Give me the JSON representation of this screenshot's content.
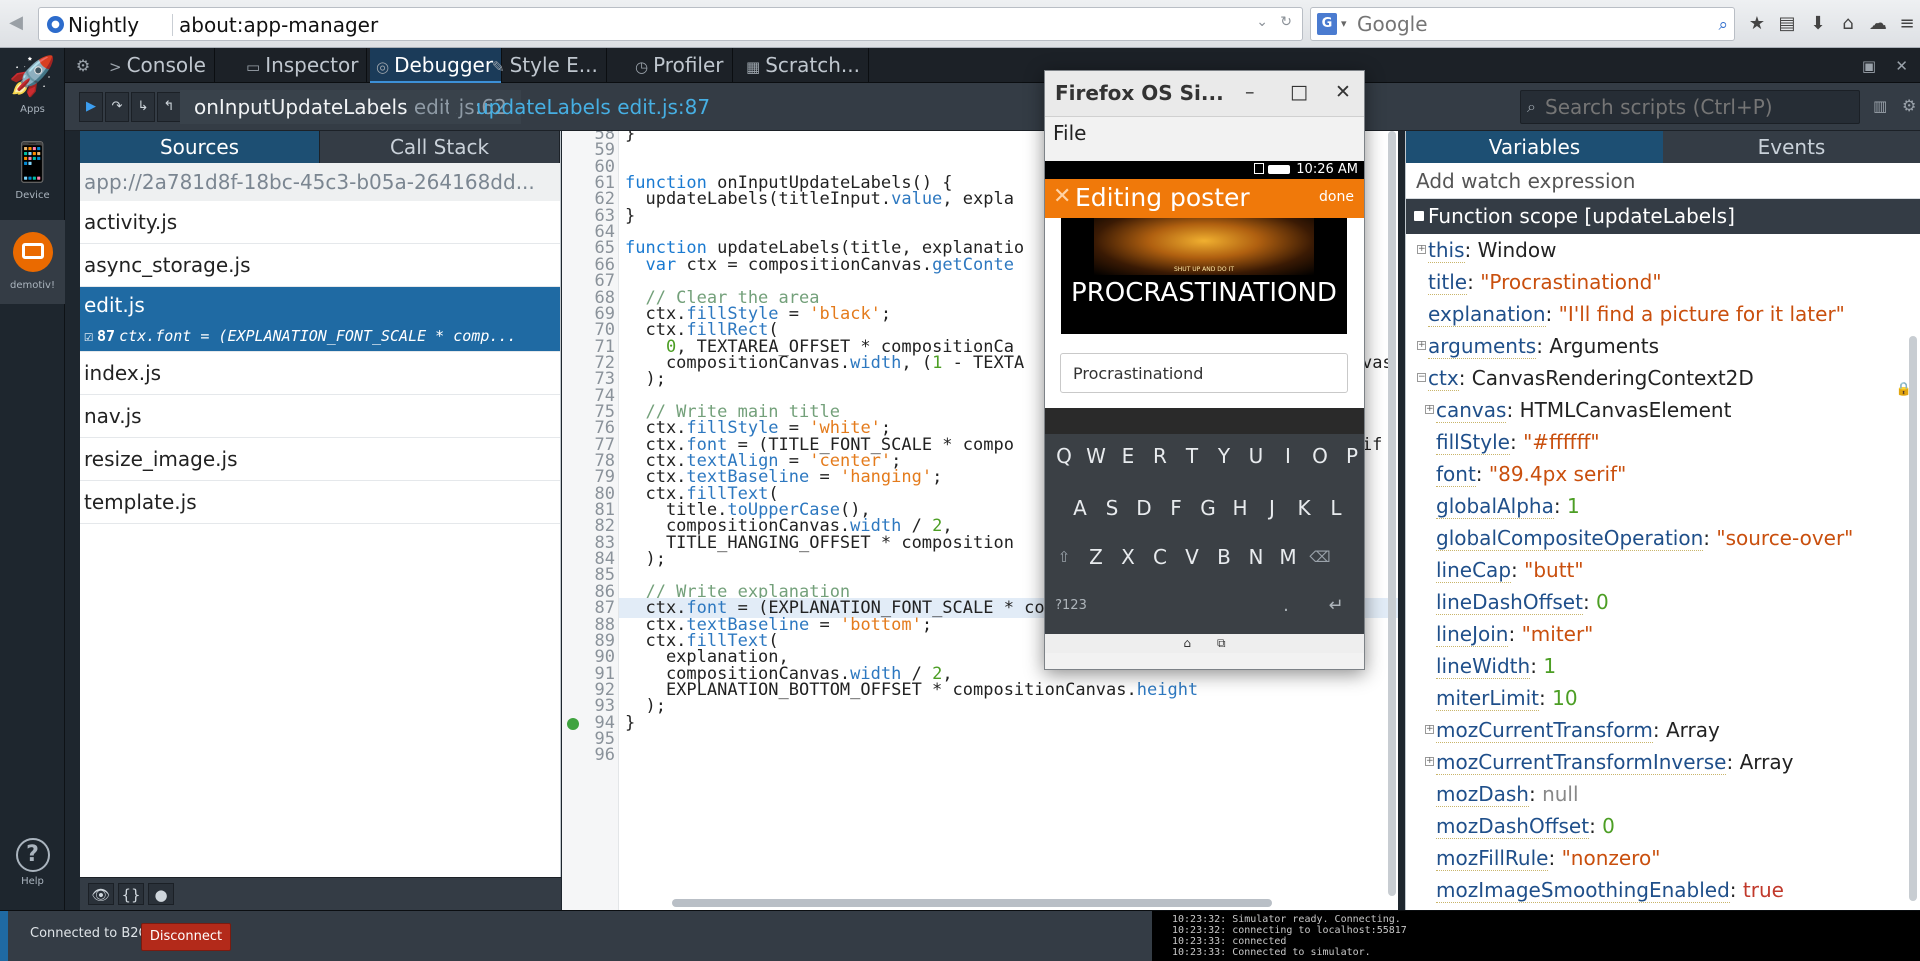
{
  "browser": {
    "brand": "Nightly",
    "url": "about:app-manager",
    "search_placeholder": "Google",
    "engine_letter": "G"
  },
  "app_sidebar": {
    "items": [
      {
        "label": "Apps"
      },
      {
        "label": "Device"
      },
      {
        "label": "demotiv!"
      }
    ],
    "help_label": "Help"
  },
  "devtools": {
    "tabs": [
      {
        "label": "Console",
        "icon": ">"
      },
      {
        "label": "Inspector",
        "icon": "▭"
      },
      {
        "label": "Debugger",
        "icon": "◎"
      },
      {
        "label": "Style E...",
        "icon": "✎"
      },
      {
        "label": "Profiler",
        "icon": "◷"
      },
      {
        "label": "Scratch...",
        "icon": "▦"
      }
    ],
    "selected_tab": "Debugger"
  },
  "debugger": {
    "breadcrumbs": [
      {
        "func": "onInputUpdateLabels",
        "file": "edit.js:62"
      },
      {
        "func": "updateLabels",
        "file": "edit.js:87"
      }
    ],
    "search_placeholder": "Search scripts (Ctrl+P)"
  },
  "sources": {
    "tabs": [
      "Sources",
      "Call Stack"
    ],
    "path": "app://2a781d8f-18bc-45c3-b05a-264168dd...",
    "files": [
      "activity.js",
      "async_storage.js",
      "edit.js",
      "index.js",
      "nav.js",
      "resize_image.js",
      "template.js"
    ],
    "selected": "edit.js",
    "breakpoint": {
      "line": "87",
      "code": "ctx.font = (EXPLANATION_FONT_SCALE * comp..."
    }
  },
  "editor": {
    "lines": [
      {
        "n": "58",
        "code": "}"
      },
      {
        "n": "59",
        "code": ""
      },
      {
        "n": "60",
        "code": ""
      },
      {
        "n": "61",
        "code": "function onInputUpdateLabels() {"
      },
      {
        "n": "62",
        "code": "  updateLabels(titleInput.value, expla"
      },
      {
        "n": "63",
        "code": "}"
      },
      {
        "n": "64",
        "code": ""
      },
      {
        "n": "65",
        "code": "function updateLabels(title, explanatio"
      },
      {
        "n": "66",
        "code": "  var ctx = compositionCanvas.getConte"
      },
      {
        "n": "67",
        "code": ""
      },
      {
        "n": "68",
        "code": "  // Clear the area"
      },
      {
        "n": "69",
        "code": "  ctx.fillStyle = 'black';"
      },
      {
        "n": "70",
        "code": "  ctx.fillRect("
      },
      {
        "n": "71",
        "code": "    0, TEXTAREA_OFFSET * compositionCa"
      },
      {
        "n": "72",
        "code": "    compositionCanvas.width, (1 - TEXTA                                 vas"
      },
      {
        "n": "73",
        "code": "  );"
      },
      {
        "n": "74",
        "code": ""
      },
      {
        "n": "75",
        "code": "  // Write main title"
      },
      {
        "n": "76",
        "code": "  ctx.fillStyle = 'white';"
      },
      {
        "n": "77",
        "code": "  ctx.font = (TITLE_FONT_SCALE * compo                                 rif"
      },
      {
        "n": "78",
        "code": "  ctx.textAlign = 'center';"
      },
      {
        "n": "79",
        "code": "  ctx.textBaseline = 'hanging';"
      },
      {
        "n": "80",
        "code": "  ctx.fillText("
      },
      {
        "n": "81",
        "code": "    title.toUpperCase(),"
      },
      {
        "n": "82",
        "code": "    compositionCanvas.width / 2,"
      },
      {
        "n": "83",
        "code": "    TITLE_HANGING_OFFSET * composition"
      },
      {
        "n": "84",
        "code": "  );"
      },
      {
        "n": "85",
        "code": ""
      },
      {
        "n": "86",
        "code": "  // Write explanation"
      },
      {
        "n": "87",
        "code": "  ctx.font = (EXPLANATION_FONT_SCALE * compositionCanvas.height) + 'px"
      },
      {
        "n": "88",
        "code": "  ctx.textBaseline = 'bottom';"
      },
      {
        "n": "89",
        "code": "  ctx.fillText("
      },
      {
        "n": "90",
        "code": "    explanation,"
      },
      {
        "n": "91",
        "code": "    compositionCanvas.width / 2,"
      },
      {
        "n": "92",
        "code": "    EXPLANATION_BOTTOM_OFFSET * compositionCanvas.height"
      },
      {
        "n": "93",
        "code": "  );"
      },
      {
        "n": "94",
        "code": "}"
      },
      {
        "n": "95",
        "code": ""
      },
      {
        "n": "96",
        "code": ""
      }
    ],
    "current_line": "87"
  },
  "variables": {
    "tabs": [
      "Variables",
      "Events"
    ],
    "watch_placeholder": "Add watch expression",
    "scope_title": "Function scope [updateLabels]",
    "rows": [
      {
        "depth": 0,
        "expand": true,
        "key": "this",
        "value": "Window",
        "kind": "obj"
      },
      {
        "depth": 0,
        "expand": false,
        "key": "title",
        "value": "\"Procrastinationd\"",
        "kind": "str"
      },
      {
        "depth": 0,
        "expand": false,
        "key": "explanation",
        "value": "\"I'll find a picture for it later\"",
        "kind": "str"
      },
      {
        "depth": 0,
        "expand": true,
        "key": "arguments",
        "value": "Arguments",
        "kind": "obj"
      },
      {
        "depth": 0,
        "expand": true,
        "open": true,
        "key": "ctx",
        "value": "CanvasRenderingContext2D",
        "kind": "obj"
      },
      {
        "depth": 1,
        "expand": true,
        "key": "canvas",
        "value": "HTMLCanvasElement",
        "kind": "obj"
      },
      {
        "depth": 1,
        "expand": false,
        "key": "fillStyle",
        "value": "\"#ffffff\"",
        "kind": "str"
      },
      {
        "depth": 1,
        "expand": false,
        "key": "font",
        "value": "\"89.4px serif\"",
        "kind": "str"
      },
      {
        "depth": 1,
        "expand": false,
        "key": "globalAlpha",
        "value": "1",
        "kind": "num"
      },
      {
        "depth": 1,
        "expand": false,
        "key": "globalCompositeOperation",
        "value": "\"source-over\"",
        "kind": "str"
      },
      {
        "depth": 1,
        "expand": false,
        "key": "lineCap",
        "value": "\"butt\"",
        "kind": "str"
      },
      {
        "depth": 1,
        "expand": false,
        "key": "lineDashOffset",
        "value": "0",
        "kind": "num"
      },
      {
        "depth": 1,
        "expand": false,
        "key": "lineJoin",
        "value": "\"miter\"",
        "kind": "str"
      },
      {
        "depth": 1,
        "expand": false,
        "key": "lineWidth",
        "value": "1",
        "kind": "num"
      },
      {
        "depth": 1,
        "expand": false,
        "key": "miterLimit",
        "value": "10",
        "kind": "num"
      },
      {
        "depth": 1,
        "expand": true,
        "key": "mozCurrentTransform",
        "value": "Array",
        "kind": "obj"
      },
      {
        "depth": 1,
        "expand": true,
        "key": "mozCurrentTransformInverse",
        "value": "Array",
        "kind": "obj"
      },
      {
        "depth": 1,
        "expand": false,
        "key": "mozDash",
        "value": "null",
        "kind": "null"
      },
      {
        "depth": 1,
        "expand": false,
        "key": "mozDashOffset",
        "value": "0",
        "kind": "num"
      },
      {
        "depth": 1,
        "expand": false,
        "key": "mozFillRule",
        "value": "\"nonzero\"",
        "kind": "str"
      },
      {
        "depth": 1,
        "expand": false,
        "key": "mozImageSmoothingEnabled",
        "value": "true",
        "kind": "bool"
      }
    ],
    "right_marker": "N"
  },
  "simulator": {
    "title": "Firefox OS Si...",
    "menu": "File",
    "time": "10:26 AM",
    "app_header": "Editing poster",
    "done": "done",
    "poster_caption": "PROCRASTINATIOND",
    "poster_art_text": "SHUT UP AND DO IT",
    "input_value": "Procrastinationd",
    "keyboard_rows": [
      [
        "Q",
        "W",
        "E",
        "R",
        "T",
        "Y",
        "U",
        "I",
        "O",
        "P"
      ],
      [
        "A",
        "S",
        "D",
        "F",
        "G",
        "H",
        "J",
        "K",
        "L"
      ],
      [
        "⇧",
        "Z",
        "X",
        "C",
        "V",
        "B",
        "N",
        "M",
        "⌫"
      ],
      [
        "?123",
        ".",
        "↵"
      ]
    ]
  },
  "bottom": {
    "status": "Connected to B2G",
    "disconnect": "Disconnect",
    "log": [
      "10:23:32: Simulator ready. Connecting.",
      "10:23:32: connecting to localhost:55817",
      "10:23:33: connected",
      "10:23:33: Connected to simulator."
    ]
  }
}
